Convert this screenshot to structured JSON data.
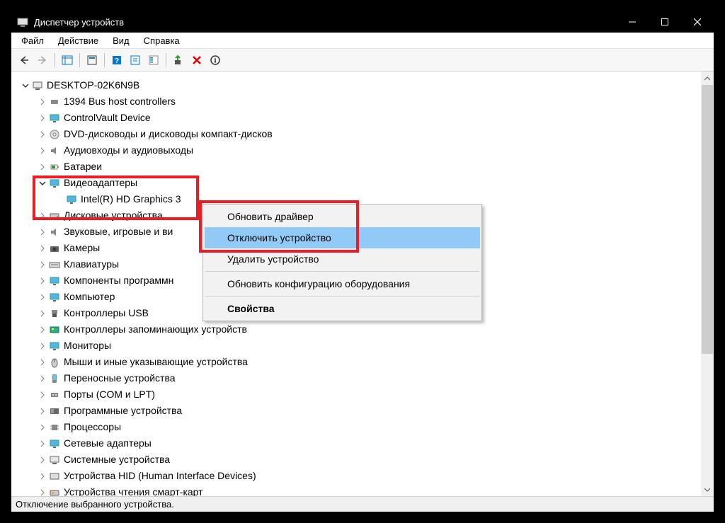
{
  "window": {
    "title": "Диспетчер устройств"
  },
  "menubar": {
    "file": "Файл",
    "action": "Действие",
    "view": "Вид",
    "help": "Справка"
  },
  "tree": {
    "root": "DESKTOP-02K6N9B",
    "items": [
      "1394 Bus host controllers",
      "ControlVault Device",
      "DVD-дисководы и дисководы компакт-дисков",
      "Аудиовходы и аудиовыходы",
      "Батареи",
      "Видеоадаптеры",
      "Intel(R) HD Graphics 3",
      "Дисковые устройства",
      "Звуковые, игровые и ви",
      "Камеры",
      "Клавиатуры",
      "Компоненты программн",
      "Компьютер",
      "Контроллеры USB",
      "Контроллеры запоминающих устройств",
      "Мониторы",
      "Мыши и иные указывающие устройства",
      "Переносные устройства",
      "Порты (COM и LPT)",
      "Программные устройства",
      "Процессоры",
      "Сетевые адаптеры",
      "Системные устройства",
      "Устройства HID (Human Interface Devices)",
      "Устройства чтения смарт-карт"
    ]
  },
  "context_menu": {
    "update": "Обновить драйвер",
    "disable": "Отключить устройство",
    "remove": "Удалить устройство",
    "scan": "Обновить конфигурацию оборудования",
    "props": "Свойства"
  },
  "statusbar": {
    "text": "Отключение выбранного устройства."
  }
}
